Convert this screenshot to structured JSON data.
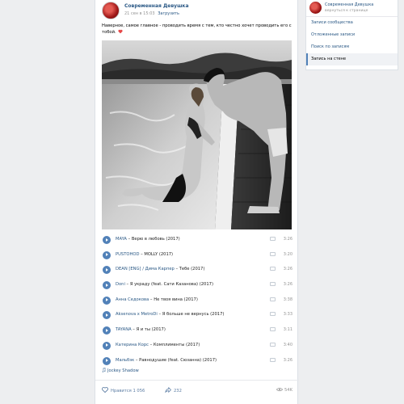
{
  "post": {
    "author": "Современная Девушка",
    "date": "21 сен в 15:03",
    "download_label": "Загрузить",
    "text": "Наверное, самое главное - проводить время с тем, кто честно хочет проводить его с тобой.",
    "playlist": [
      {
        "artist": "MAYA",
        "title": "Верю в любовь (2017)",
        "duration": "3:26"
      },
      {
        "artist": "PUSTOHOD",
        "title": "MOLLY (2017)",
        "duration": "3:20"
      },
      {
        "artist": "DEAN [ENG] / Дима Карпер",
        "title": "Тебе (2017)",
        "duration": "3:26"
      },
      {
        "artist": "Doni",
        "title": "Я украду (feat. Сати Казанова) (2017)",
        "duration": "3:26"
      },
      {
        "artist": "Анна Седокова",
        "title": "Не твоя вина (2017)",
        "duration": "3:38"
      },
      {
        "artist": "Aksenova x MetroDi",
        "title": "Я больше не вернусь (2017)",
        "duration": "3:33"
      },
      {
        "artist": "TAYANA",
        "title": "Я и ты (2017)",
        "duration": "3:11"
      },
      {
        "artist": "Катерина Корс",
        "title": "Комплименты (2017)",
        "duration": "3:40"
      },
      {
        "artist": "Мальбэк",
        "title": "Равнодушие (feat. Сюзанна) (2017)",
        "duration": "3:26"
      }
    ],
    "attachment": "Jockey Shadow",
    "likes_label": "Нравится 1 056",
    "shares": "232",
    "views": "54K"
  },
  "sidebar": {
    "name": "Современная Девушка",
    "back_label": "вернуться к странице",
    "items": [
      {
        "label": "Записи сообщества"
      },
      {
        "label": "Отложенные записи"
      },
      {
        "label": "Поиск по записям"
      },
      {
        "label": "Запись на стене"
      }
    ]
  },
  "colors": {
    "link": "#2a5885",
    "accent": "#5181b8",
    "muted": "#939393",
    "heart": "#e64646"
  },
  "icons": [
    "heart-icon",
    "play-icon",
    "note-icon",
    "like-icon",
    "share-icon",
    "eye-icon"
  ]
}
